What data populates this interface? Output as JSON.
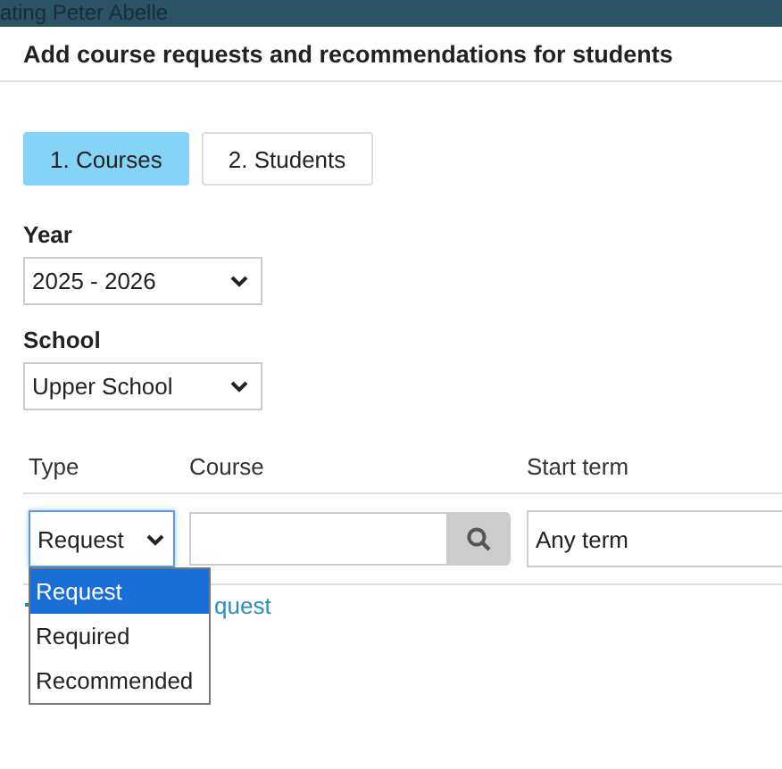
{
  "background_page": {
    "title": "ating Peter Abelle"
  },
  "dialog": {
    "title": "Add course requests and recommendations for students",
    "steps": [
      {
        "label": "1. Courses",
        "selected": true
      },
      {
        "label": "2. Students",
        "selected": false
      }
    ],
    "year": {
      "label": "Year",
      "value": "2025 - 2026"
    },
    "school": {
      "label": "School",
      "value": "Upper School"
    },
    "table": {
      "columns": [
        "Type",
        "Course",
        "Start term"
      ],
      "row": {
        "type": {
          "value": "Request",
          "open": true,
          "options": [
            {
              "label": "Request",
              "selected": true
            },
            {
              "label": "Required",
              "selected": false
            },
            {
              "label": "Recommended",
              "selected": false
            }
          ]
        },
        "start_term": {
          "value": "Any term"
        }
      }
    },
    "add_link": {
      "text": "quest"
    }
  }
}
